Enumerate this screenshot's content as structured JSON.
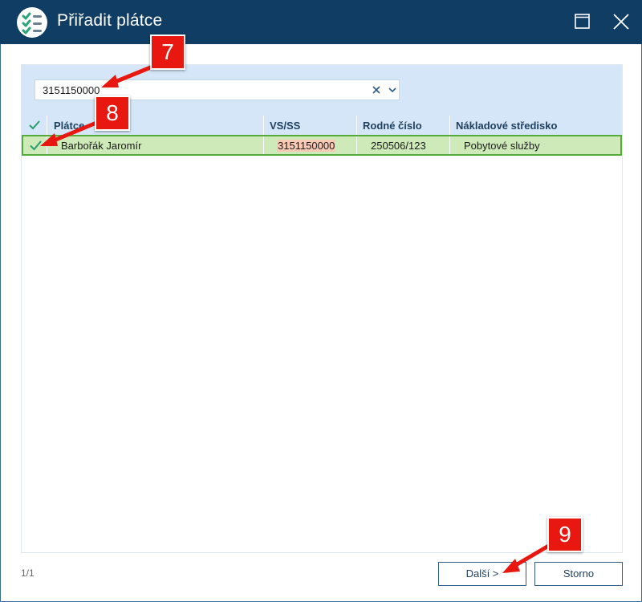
{
  "window": {
    "title": "Přiřadit plátce",
    "controls": [
      "maximize-icon",
      "close-icon"
    ]
  },
  "search": {
    "value": "3151150000"
  },
  "table": {
    "columns": [
      "Plátce",
      "VS/SS",
      "Rodné číslo",
      "Nákladové středisko"
    ],
    "rows": [
      {
        "checked": true,
        "platce": "Barbořák Jaromír",
        "vs_ss": "3151150000",
        "rodne_cislo": "250506/123",
        "nakladove_stredisko": "Pobytové služby"
      }
    ]
  },
  "pager": "1/1",
  "buttons": {
    "next": "Další >",
    "cancel": "Storno"
  },
  "callouts": [
    "7",
    "8",
    "9"
  ],
  "colors": {
    "titlebar": "#0f3d63",
    "header_bg": "#d4e6f7",
    "selected_row": "#cdeab8",
    "selected_border": "#55aa3a",
    "accent_check": "#2a9d6e",
    "callout_red": "#e8170f"
  }
}
